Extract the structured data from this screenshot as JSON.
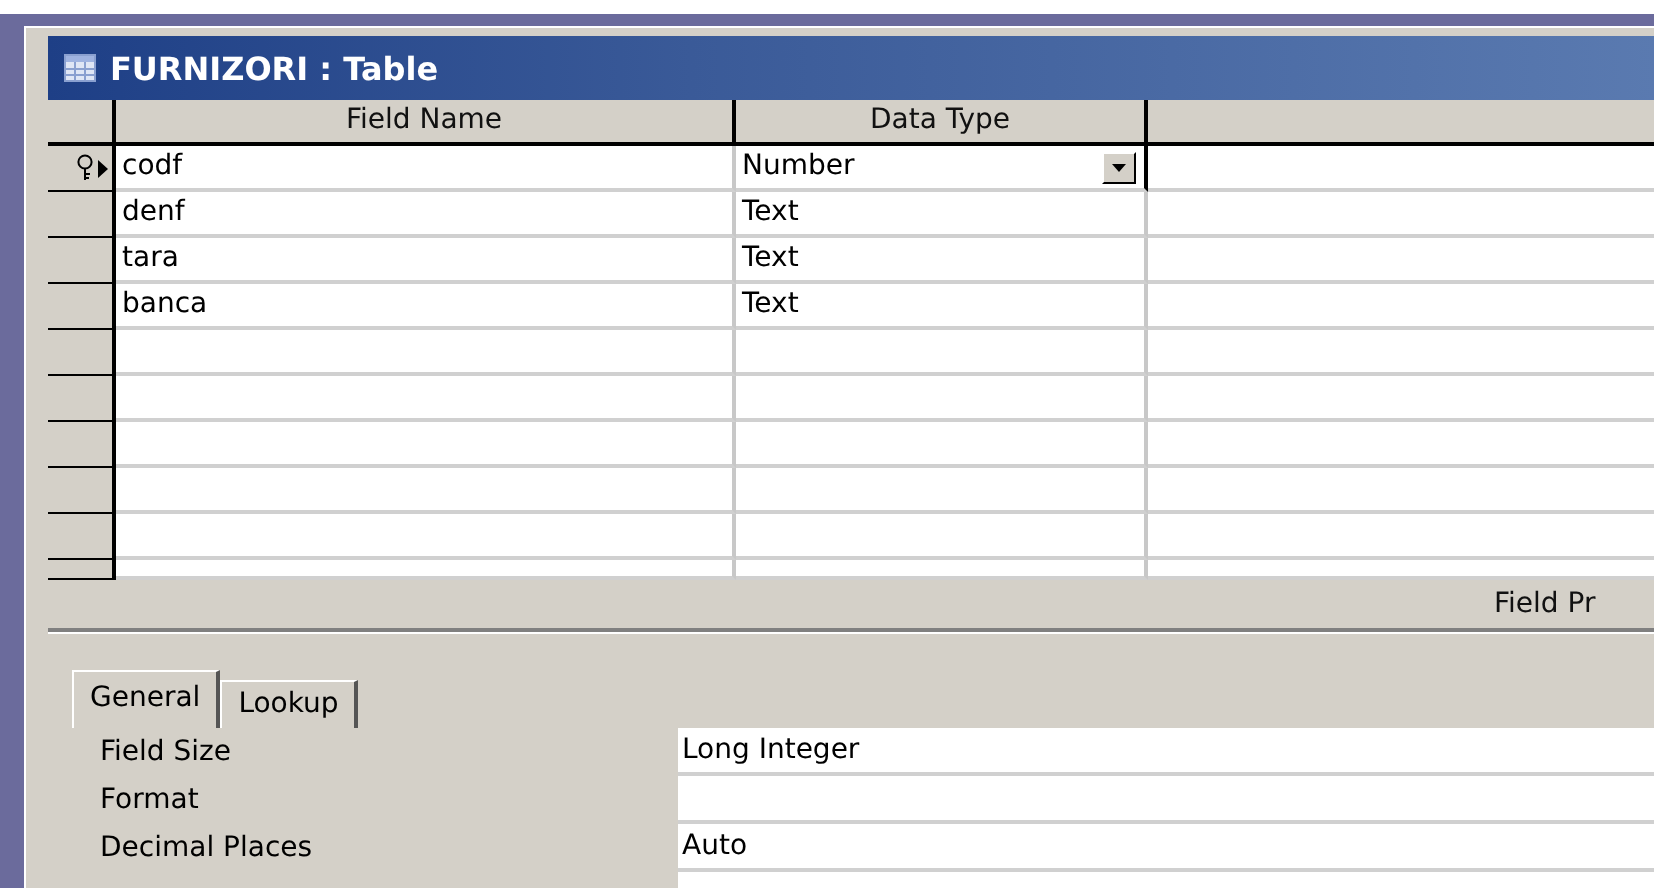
{
  "window": {
    "title": "FURNIZORI : Table"
  },
  "columns": [
    "Field Name",
    "Data Type"
  ],
  "rows": [
    {
      "field_name": "codf",
      "data_type": "Number",
      "primary_key": true,
      "selected": true
    },
    {
      "field_name": "denf",
      "data_type": "Text",
      "primary_key": false,
      "selected": false
    },
    {
      "field_name": "tara",
      "data_type": "Text",
      "primary_key": false,
      "selected": false
    },
    {
      "field_name": "banca",
      "data_type": "Text",
      "primary_key": false,
      "selected": false
    }
  ],
  "properties_heading": "Field Pr",
  "tabs": [
    {
      "label": "General",
      "selected": true
    },
    {
      "label": "Lookup",
      "selected": false
    }
  ],
  "properties": [
    {
      "label": "Field Size",
      "value": "Long Integer"
    },
    {
      "label": "Format"
    },
    {
      "label": "Decimal Places",
      "value": "Auto"
    }
  ]
}
